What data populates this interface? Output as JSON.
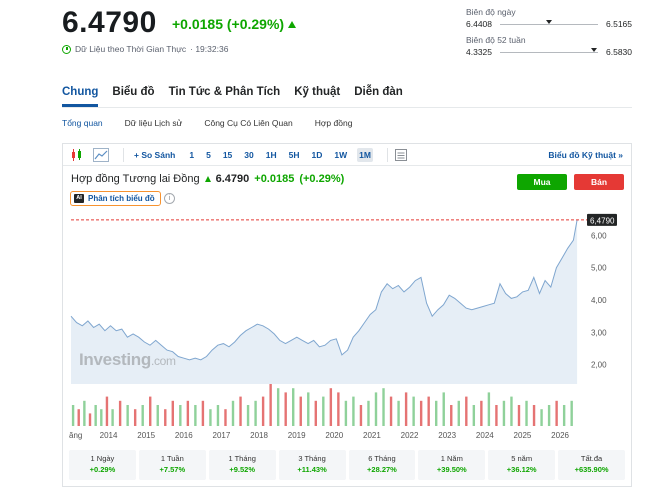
{
  "quote": {
    "price": "6.4790",
    "change": "+0.0185 (+0.29%)",
    "realtime_label": "Dữ Liệu theo Thời Gian Thực",
    "time": "· 19:32:36"
  },
  "day_range": {
    "label": "Biên độ ngày",
    "low": "6.4408",
    "high": "6.5165",
    "position": 0.5
  },
  "week52_range": {
    "label": "Biên độ 52 tuần",
    "low": "4.3325",
    "high": "6.5830",
    "position": 0.96
  },
  "main_tabs": [
    {
      "label": "Chung",
      "active": true
    },
    {
      "label": "Biểu đồ"
    },
    {
      "label": "Tin Tức & Phân Tích"
    },
    {
      "label": "Kỹ thuật"
    },
    {
      "label": "Diễn đàn"
    }
  ],
  "sub_tabs": [
    {
      "label": "Tổng quan",
      "active": true
    },
    {
      "label": "Dữ liệu Lịch sử"
    },
    {
      "label": "Công Cụ Có Liên Quan"
    },
    {
      "label": "Hợp đồng"
    }
  ],
  "toolbar": {
    "compare_label": "+ So Sánh",
    "timeframes": [
      "1",
      "5",
      "15",
      "30",
      "1H",
      "5H",
      "1D",
      "1W",
      "1M"
    ],
    "active_timeframe": "1M",
    "technical_link": "Biểu đồ Kỹ thuật »"
  },
  "instrument": {
    "name": "Hợp đồng Tương lai Đồng",
    "price": "6.4790",
    "change": "+0.0185",
    "change_pct": "(+0.29%)"
  },
  "actions": {
    "buy": "Mua",
    "sell": "Bán"
  },
  "analysis_button": {
    "badge": "AI",
    "label": "Phân tích biểu đồ",
    "info": "i"
  },
  "watermark": {
    "brand": "Investing",
    "suffix": ".com"
  },
  "colors": {
    "up": "#0ea600",
    "down": "#e53935",
    "accent": "#1256a0",
    "line": "#7fa6cf",
    "area": "#e3ecf5"
  },
  "chart_data": {
    "type": "area",
    "x_labels": [
      "ăng",
      "2014",
      "2015",
      "2016",
      "2017",
      "2018",
      "2019",
      "2020",
      "2021",
      "2022",
      "2023",
      "2024",
      "2025",
      "2026"
    ],
    "ylim": [
      1.4,
      6.6
    ],
    "y_ticks": [
      "6,00",
      "5,00",
      "4,00",
      "3,00",
      "2,00"
    ],
    "y_tick_values": [
      6,
      5,
      4,
      3,
      2
    ],
    "current_value": 6.479,
    "current_label": "6,4790",
    "series": [
      {
        "x": [
          2013.0,
          2013.15,
          2013.3,
          2013.45,
          2013.6,
          2013.75,
          2013.9,
          2014.05,
          2014.2,
          2014.35,
          2014.5,
          2014.65,
          2014.8,
          2014.95,
          2015.1,
          2015.25,
          2015.4,
          2015.55,
          2015.7,
          2015.85,
          2016.0,
          2016.15,
          2016.3,
          2016.45,
          2016.6,
          2016.75,
          2016.9,
          2017.05,
          2017.2,
          2017.35,
          2017.5,
          2017.65,
          2017.8,
          2017.95,
          2018.1,
          2018.25,
          2018.4,
          2018.55,
          2018.7,
          2018.85,
          2019.0,
          2019.15,
          2019.3,
          2019.45,
          2019.6,
          2019.75,
          2019.9,
          2020.05,
          2020.2,
          2020.35,
          2020.5,
          2020.65,
          2020.8,
          2020.95,
          2021.1,
          2021.25,
          2021.4,
          2021.55,
          2021.7,
          2021.85,
          2022.0,
          2022.15,
          2022.3,
          2022.45,
          2022.6,
          2022.75,
          2022.9,
          2023.05,
          2023.2,
          2023.35,
          2023.5,
          2023.65,
          2023.8,
          2023.95,
          2024.1,
          2024.25,
          2024.4,
          2024.55,
          2024.7,
          2024.85,
          2025.0,
          2025.15,
          2025.3,
          2025.45,
          2025.6,
          2025.75,
          2025.9,
          2026.05,
          2026.2,
          2026.35,
          2026.45
        ],
        "y": [
          3.5,
          3.3,
          3.2,
          3.35,
          3.15,
          3.25,
          3.05,
          3.2,
          3.05,
          3.1,
          2.85,
          2.95,
          2.85,
          2.7,
          2.6,
          2.75,
          2.6,
          2.45,
          2.4,
          2.25,
          2.2,
          2.15,
          2.2,
          2.15,
          2.25,
          2.45,
          2.6,
          2.65,
          2.55,
          2.7,
          2.9,
          3.05,
          3.15,
          3.25,
          3.2,
          3.1,
          2.95,
          2.75,
          2.65,
          2.75,
          2.85,
          2.75,
          2.65,
          2.75,
          2.55,
          2.6,
          2.75,
          2.8,
          2.3,
          2.45,
          2.85,
          3.05,
          3.3,
          3.55,
          3.7,
          4.25,
          4.5,
          4.35,
          4.45,
          4.25,
          4.4,
          4.6,
          4.7,
          3.9,
          3.5,
          3.7,
          3.85,
          4.15,
          4.05,
          3.9,
          3.75,
          3.7,
          3.75,
          3.8,
          3.85,
          3.9,
          4.5,
          4.2,
          4.05,
          4.1,
          4.25,
          4.3,
          4.7,
          4.2,
          4.6,
          4.4,
          5.0,
          5.3,
          5.6,
          5.85,
          6.48
        ]
      }
    ],
    "volume": {
      "x": [
        2013.05,
        2013.2,
        2013.35,
        2013.5,
        2013.65,
        2013.8,
        2013.95,
        2014.1,
        2014.3,
        2014.5,
        2014.7,
        2014.9,
        2015.1,
        2015.3,
        2015.5,
        2015.7,
        2015.9,
        2016.1,
        2016.3,
        2016.5,
        2016.7,
        2016.9,
        2017.1,
        2017.3,
        2017.5,
        2017.7,
        2017.9,
        2018.1,
        2018.3,
        2018.5,
        2018.7,
        2018.9,
        2019.1,
        2019.3,
        2019.5,
        2019.7,
        2019.9,
        2020.1,
        2020.3,
        2020.5,
        2020.7,
        2020.9,
        2021.1,
        2021.3,
        2021.5,
        2021.7,
        2021.9,
        2022.1,
        2022.3,
        2022.5,
        2022.7,
        2022.9,
        2023.1,
        2023.3,
        2023.5,
        2023.7,
        2023.9,
        2024.1,
        2024.3,
        2024.5,
        2024.7,
        2024.9,
        2025.1,
        2025.3,
        2025.5,
        2025.7,
        2025.9,
        2026.1,
        2026.3
      ],
      "values": [
        0.5,
        0.4,
        0.6,
        0.3,
        0.5,
        0.4,
        0.7,
        0.4,
        0.6,
        0.5,
        0.4,
        0.5,
        0.7,
        0.5,
        0.4,
        0.6,
        0.5,
        0.6,
        0.5,
        0.6,
        0.4,
        0.5,
        0.4,
        0.6,
        0.7,
        0.5,
        0.6,
        0.7,
        1.0,
        0.9,
        0.8,
        0.9,
        0.7,
        0.8,
        0.6,
        0.7,
        0.9,
        0.8,
        0.6,
        0.7,
        0.5,
        0.6,
        0.8,
        0.9,
        0.7,
        0.6,
        0.8,
        0.7,
        0.6,
        0.7,
        0.6,
        0.8,
        0.5,
        0.6,
        0.7,
        0.5,
        0.6,
        0.8,
        0.5,
        0.6,
        0.7,
        0.5,
        0.6,
        0.5,
        0.4,
        0.5,
        0.6,
        0.5,
        0.6
      ],
      "direction": [
        "up",
        "down",
        "up",
        "down",
        "up",
        "up",
        "down",
        "up",
        "down",
        "up",
        "down",
        "up",
        "down",
        "up",
        "down",
        "down",
        "up",
        "down",
        "up",
        "down",
        "up",
        "up",
        "down",
        "up",
        "down",
        "up",
        "up",
        "down",
        "down",
        "up",
        "down",
        "up",
        "down",
        "up",
        "down",
        "up",
        "down",
        "down",
        "up",
        "up",
        "down",
        "up",
        "up",
        "up",
        "down",
        "up",
        "down",
        "up",
        "down",
        "down",
        "up",
        "up",
        "down",
        "up",
        "down",
        "up",
        "down",
        "up",
        "down",
        "up",
        "up",
        "down",
        "up",
        "down",
        "up",
        "up",
        "down",
        "up",
        "up"
      ]
    }
  },
  "performance": [
    {
      "label": "1 Ngày",
      "value": "+0.29%"
    },
    {
      "label": "1 Tuần",
      "value": "+7.57%"
    },
    {
      "label": "1 Tháng",
      "value": "+9.52%"
    },
    {
      "label": "3 Tháng",
      "value": "+11.43%"
    },
    {
      "label": "6 Tháng",
      "value": "+28.27%"
    },
    {
      "label": "1 Năm",
      "value": "+39.50%"
    },
    {
      "label": "5 năm",
      "value": "+36.12%"
    },
    {
      "label": "Tất.đa",
      "value": "+635.90%"
    }
  ]
}
